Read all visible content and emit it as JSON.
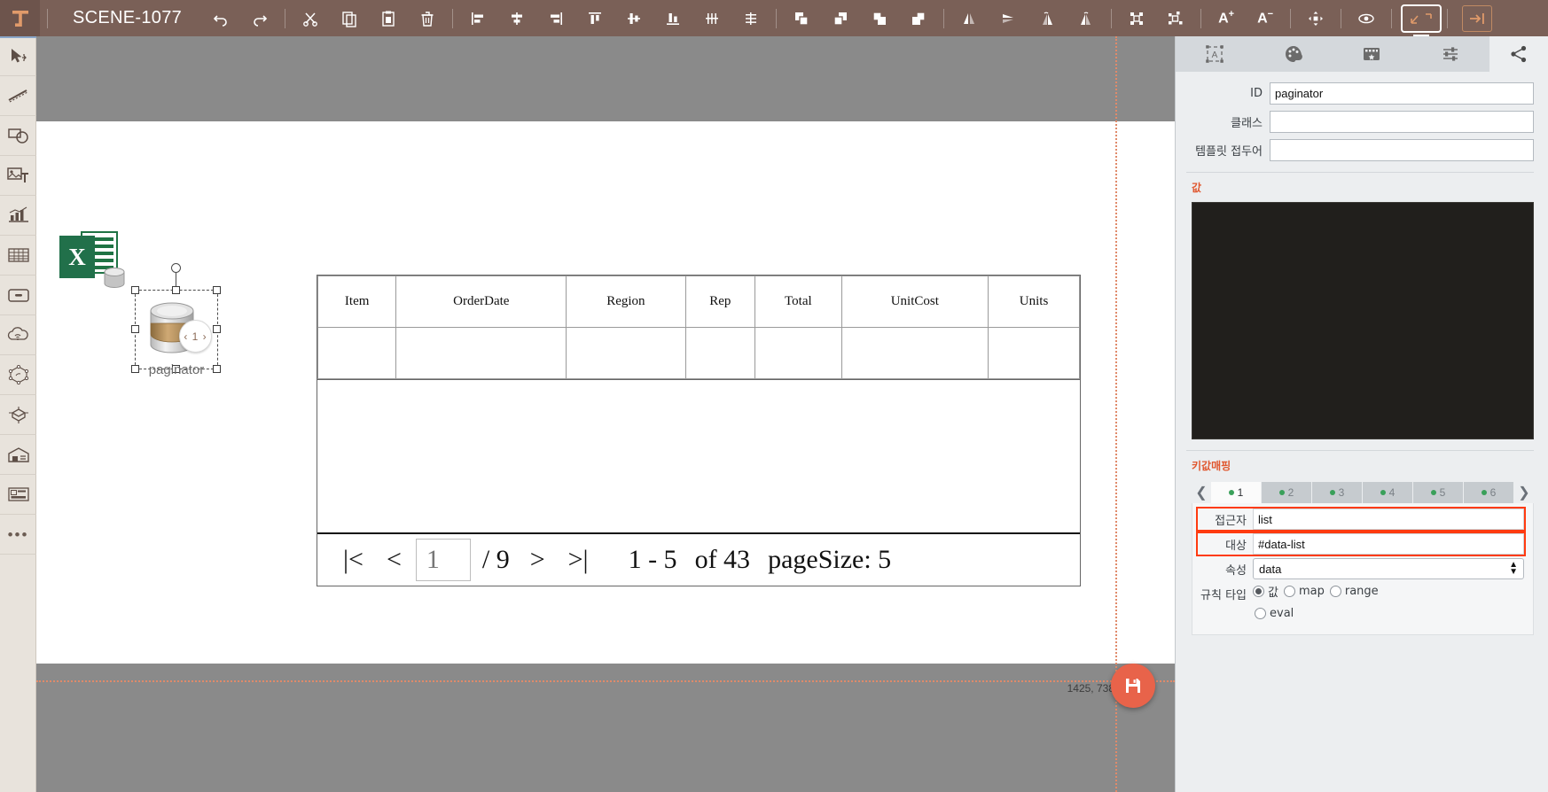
{
  "topbar": {
    "logo_icon": "t-logo-icon",
    "scene_title": "SCENE-1077",
    "tools": [
      {
        "name": "undo-button",
        "icon": "undo-icon"
      },
      {
        "name": "redo-button",
        "icon": "redo-icon"
      },
      {
        "name": "cut-button",
        "icon": "scissors-icon"
      },
      {
        "name": "copy-button",
        "icon": "copy-icon"
      },
      {
        "name": "paste-button",
        "icon": "paste-icon"
      },
      {
        "name": "delete-button",
        "icon": "trash-icon"
      },
      {
        "name": "align-left-button",
        "icon": "align-left-icon"
      },
      {
        "name": "align-center-h-button",
        "icon": "align-center-horizontal-icon"
      },
      {
        "name": "align-right-button",
        "icon": "align-right-icon"
      },
      {
        "name": "align-top-button",
        "icon": "align-top-icon"
      },
      {
        "name": "align-middle-v-button",
        "icon": "align-middle-vertical-icon"
      },
      {
        "name": "align-bottom-button",
        "icon": "align-bottom-icon"
      },
      {
        "name": "distribute-horizontal-button",
        "icon": "distribute-horizontal-icon"
      },
      {
        "name": "distribute-vertical-button",
        "icon": "distribute-vertical-icon"
      },
      {
        "name": "bring-to-front-button",
        "icon": "bring-to-front-icon"
      },
      {
        "name": "bring-forward-button",
        "icon": "bring-forward-icon"
      },
      {
        "name": "send-backward-button",
        "icon": "send-backward-icon"
      },
      {
        "name": "send-to-back-button",
        "icon": "send-to-back-icon"
      },
      {
        "name": "flip-horizontal-button",
        "icon": "flip-horizontal-icon"
      },
      {
        "name": "flip-vertical-button",
        "icon": "flip-vertical-icon"
      },
      {
        "name": "rotate-left-button",
        "icon": "rotate-left-icon"
      },
      {
        "name": "rotate-right-button",
        "icon": "rotate-right-icon"
      },
      {
        "name": "group-button",
        "icon": "group-icon"
      },
      {
        "name": "ungroup-button",
        "icon": "ungroup-icon"
      }
    ],
    "font_increase_label": "A",
    "font_increase_sup": "+",
    "font_decrease_label": "A",
    "font_decrease_sup": "−",
    "move_icon": "move-icon",
    "preview_icon": "eye-icon",
    "present_icon": "presentation-icon",
    "collapse_icon": "collapse-right-icon"
  },
  "leftbar": {
    "items": [
      {
        "name": "sidebar-item-select",
        "icon": "cursor-move-icon"
      },
      {
        "name": "sidebar-item-path",
        "icon": "dashed-path-icon"
      },
      {
        "name": "sidebar-item-shapes",
        "icon": "shapes-icon"
      },
      {
        "name": "sidebar-item-media-text",
        "icon": "image-text-icon"
      },
      {
        "name": "sidebar-item-chart",
        "icon": "chart-icon"
      },
      {
        "name": "sidebar-item-table",
        "icon": "table-grid-icon"
      },
      {
        "name": "sidebar-item-container",
        "icon": "drawer-icon"
      },
      {
        "name": "sidebar-item-cloud",
        "icon": "cloud-wifi-icon"
      },
      {
        "name": "sidebar-item-network",
        "icon": "network-node-icon"
      },
      {
        "name": "sidebar-item-3d",
        "icon": "cube-3d-icon"
      },
      {
        "name": "sidebar-item-warehouse",
        "icon": "warehouse-icon"
      },
      {
        "name": "sidebar-item-form",
        "icon": "form-card-icon"
      },
      {
        "name": "sidebar-item-more",
        "icon": "ellipsis-icon",
        "glyph": "•••"
      }
    ]
  },
  "canvas": {
    "excel_icon": "excel-db-icon",
    "excel_letter": "X",
    "coordinates": "1425, 738",
    "save_icon": "save-disk-icon",
    "selected_node": {
      "name": "paginator-node",
      "label": "paginator",
      "badge_text": "‹ 1 ›",
      "icon": "database-cylinder-icon"
    }
  },
  "table": {
    "columns": [
      "Item",
      "OrderDate",
      "Region",
      "Rep",
      "Total",
      "UnitCost",
      "Units"
    ],
    "rows": [
      [
        "",
        "",
        "",
        "",
        "",
        "",
        ""
      ]
    ]
  },
  "paginator": {
    "first_label": "|<",
    "prev_label": "<",
    "page_value": "1",
    "total_pages_label": "/ 9",
    "next_label": ">",
    "last_label": ">|",
    "range_label": "1  -  5",
    "of_label": "of 43",
    "page_size_label": "pageSize: 5"
  },
  "rightpanel": {
    "tabs": [
      {
        "name": "tab-properties",
        "icon": "text-frame-icon"
      },
      {
        "name": "tab-style",
        "icon": "palette-icon"
      },
      {
        "name": "tab-animation",
        "icon": "film-icon"
      },
      {
        "name": "tab-settings",
        "icon": "sliders-icon"
      },
      {
        "name": "tab-share",
        "icon": "share-icon"
      }
    ],
    "fields": [
      {
        "name": "id-field",
        "label": "ID",
        "value": "paginator",
        "placeholder": ""
      },
      {
        "name": "class-field",
        "label": "클래스",
        "value": "",
        "placeholder": ""
      },
      {
        "name": "template-prefix-field",
        "label": "템플릿 접두어",
        "value": "",
        "placeholder": ""
      }
    ],
    "value_section_title": "값",
    "kvm_section_title": "키값매핑",
    "kvm_tabs": [
      "1",
      "2",
      "3",
      "4",
      "5",
      "6"
    ],
    "kvm_active_index": 0,
    "kvm_prev_icon": "chevron-left-icon",
    "kvm_next_icon": "chevron-right-icon",
    "kvm_fields": [
      {
        "name": "accessor-field",
        "label": "접근자",
        "value": "list",
        "highlight": true
      },
      {
        "name": "target-field",
        "label": "대상",
        "value": "#data-list",
        "highlight": true
      }
    ],
    "property_label": "속성",
    "property_value": "data",
    "rule_type_label": "규칙 타입",
    "rule_options": [
      {
        "name": "rule-option-value",
        "label": "값",
        "selected": true
      },
      {
        "name": "rule-option-map",
        "label": "map",
        "selected": false
      },
      {
        "name": "rule-option-range",
        "label": "range",
        "selected": false
      },
      {
        "name": "rule-option-eval",
        "label": "eval",
        "selected": false
      }
    ]
  },
  "colors": {
    "topbar": "#7a6057",
    "accent": "#e0572f",
    "highlight": "#ff3b10",
    "fab": "#e8634a",
    "guide": "#e08a6a"
  }
}
